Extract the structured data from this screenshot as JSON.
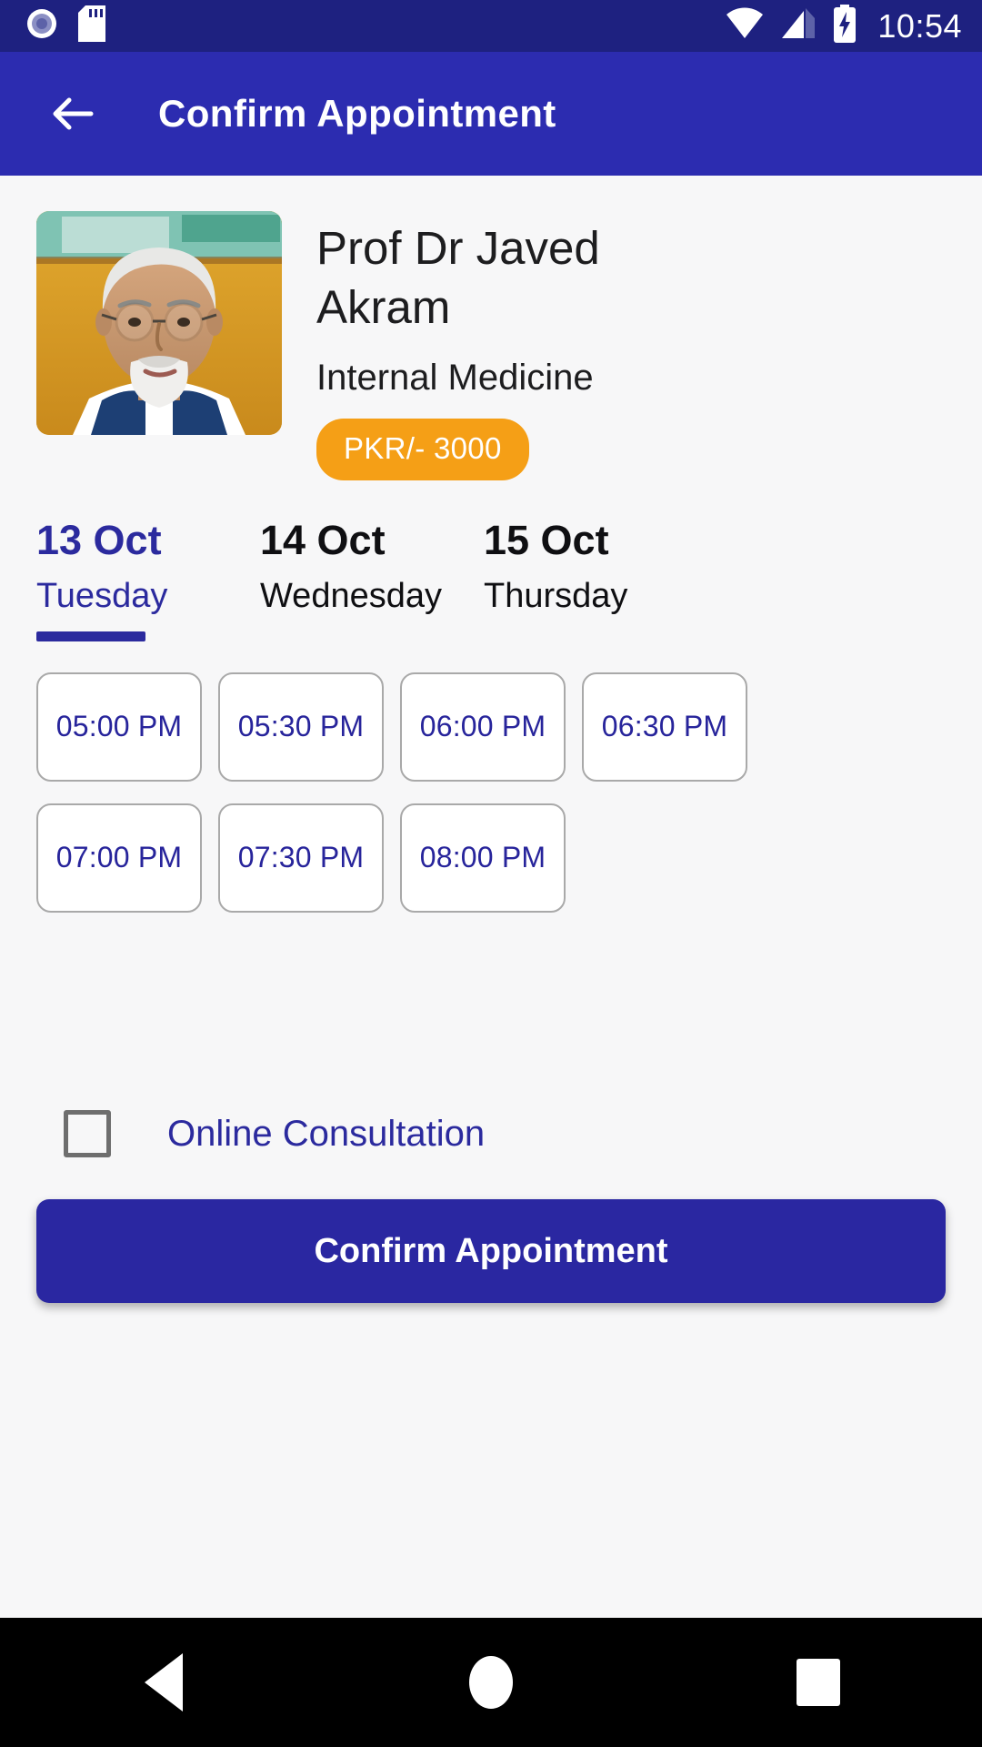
{
  "status_bar": {
    "time": "10:54",
    "icons": [
      "camera-icon",
      "sd-card-icon",
      "wifi-icon",
      "cellular-signal-icon",
      "battery-charging-icon"
    ]
  },
  "app_bar": {
    "title": "Confirm Appointment",
    "back_icon": "back-arrow-icon"
  },
  "doctor": {
    "name": "Prof Dr Javed Akram",
    "specialty": "Internal Medicine",
    "fee": "PKR/- 3000",
    "photo_alt": "doctor-portrait"
  },
  "date_tabs": [
    {
      "date": "13 Oct",
      "day": "Tuesday",
      "active": true
    },
    {
      "date": "14 Oct",
      "day": "Wednesday",
      "active": false
    },
    {
      "date": "15 Oct",
      "day": "Thursday",
      "active": false
    }
  ],
  "slots": [
    "05:00 PM",
    "05:30 PM",
    "06:00 PM",
    "06:30 PM",
    "07:00 PM",
    "07:30 PM",
    "08:00 PM"
  ],
  "online_consultation": {
    "label": "Online Consultation",
    "checked": false
  },
  "confirm_button": {
    "label": "Confirm Appointment"
  },
  "nav_bar": {
    "back": "nav-back-icon",
    "home": "nav-home-icon",
    "recents": "nav-recents-icon"
  },
  "colors": {
    "status_bar": "#1e2180",
    "app_bar": "#2c2cb0",
    "accent_indigo": "#2b2a9e",
    "badge_orange": "#f59f16",
    "page_background": "#f7f7f8",
    "slot_border": "#a9a9a9"
  }
}
